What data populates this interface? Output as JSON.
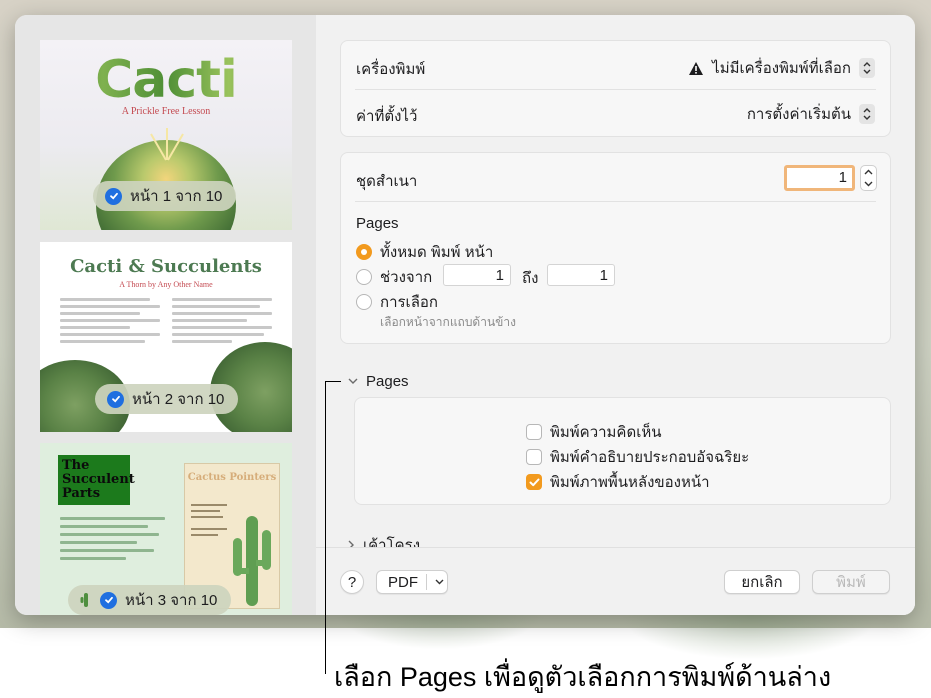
{
  "thumbnails": {
    "page1": {
      "title": "Cacti",
      "subtitle": "A Prickle Free Lesson",
      "badge": "หน้า 1 จาก 10"
    },
    "page2": {
      "title": "Cacti & Succulents",
      "subtitle": "A Thorn by Any Other Name",
      "badge": "หน้า 2 จาก 10"
    },
    "page3": {
      "title": "The Succulent Parts",
      "card_title": "Cactus Pointers",
      "badge": "หน้า 3 จาก 10"
    }
  },
  "printer": {
    "label": "เครื่องพิมพ์",
    "value": "ไม่มีเครื่องพิมพ์ที่เลือก",
    "warning_icon": "warning-triangle-icon"
  },
  "presets": {
    "label": "ค่าที่ตั้งไว้",
    "value": "การตั้งค่าเริ่มต้น"
  },
  "copies": {
    "label": "ชุดสำเนา",
    "value": "1"
  },
  "pages_range": {
    "heading": "Pages",
    "all_label": "ทั้งหมด พิมพ์ หน้า",
    "range_label": "ช่วงจาก",
    "range_from": "1",
    "range_to_label": "ถึง",
    "range_to": "1",
    "selection_label": "การเลือก",
    "selection_hint": "เลือกหน้าจากแถบด้านข้าง"
  },
  "pages_section": {
    "title": "Pages",
    "options": [
      {
        "label": "พิมพ์ความคิดเห็น",
        "checked": false
      },
      {
        "label": "พิมพ์คำอธิบายประกอบอัจฉริยะ",
        "checked": false
      },
      {
        "label": "พิมพ์ภาพพื้นหลังของหน้า",
        "checked": true
      }
    ]
  },
  "layout_section": {
    "title": "เค้าโครง"
  },
  "bottom": {
    "help_label": "?",
    "pdf_label": "PDF",
    "cancel_label": "ยกเลิก",
    "print_label": "พิมพ์"
  },
  "caption": "เลือก Pages เพื่อดูตัวเลือกการพิมพ์ด้านล่าง",
  "colors": {
    "accent": "#f29a1e",
    "check_blue": "#1f6fe0"
  }
}
